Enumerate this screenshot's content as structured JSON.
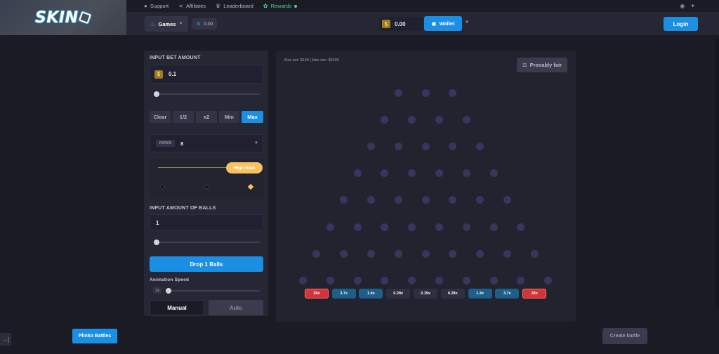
{
  "header": {
    "logo_text": "SKIN",
    "nav": [
      {
        "label": "Support",
        "icon": "user-icon"
      },
      {
        "label": "Affiliates",
        "icon": "share-icon"
      },
      {
        "label": "Leaderboard",
        "icon": "trophy-icon"
      },
      {
        "label": "Rewards",
        "icon": "gift-icon",
        "active": true
      }
    ],
    "games_label": "Games",
    "x_value": "0.00",
    "balance": "0.00",
    "coin_symbol": "$",
    "wallet_label": "Wallet",
    "login_label": "Login"
  },
  "controls": {
    "bet_label": "INPUT BET AMOUNT",
    "bet_value": "0.1",
    "quick_buttons": [
      "Clear",
      "1/2",
      "x2",
      "Min",
      "Max"
    ],
    "rows_tag": "ROWS",
    "rows_value": "8",
    "risk_label": "High Risk",
    "balls_label": "INPUT AMOUNT OF BALLS",
    "balls_value": "1",
    "drop_label": "Drop 1 Balls",
    "speed_label": "Animation Speed",
    "speed_value": "1x",
    "mode_manual": "Manual",
    "mode_auto": "Auto"
  },
  "board": {
    "limits": "Max bet: $100 | Max win: $5000",
    "fair_label": "Provably fair",
    "peg_rows": 8,
    "buckets": [
      {
        "label": "28x",
        "tier": "high"
      },
      {
        "label": "3.7x",
        "tier": "mid"
      },
      {
        "label": "1.4x",
        "tier": "mid"
      },
      {
        "label": "0.28x",
        "tier": "low"
      },
      {
        "label": "0.19x",
        "tier": "low"
      },
      {
        "label": "0.28x",
        "tier": "low"
      },
      {
        "label": "1.4x",
        "tier": "mid"
      },
      {
        "label": "3.7x",
        "tier": "mid"
      },
      {
        "label": "28x",
        "tier": "high"
      }
    ]
  },
  "footer": {
    "battles_label": "Plinko Battles",
    "create_label": "Create battle"
  },
  "colors": {
    "accent": "#1a8fe3",
    "rewards": "#3ddc97",
    "risk": "#f7c362",
    "bucket_high": "#d3343a",
    "bucket_mid": "#1d5f8a",
    "bucket_low": "#2e3040",
    "peg": "#35385e"
  }
}
